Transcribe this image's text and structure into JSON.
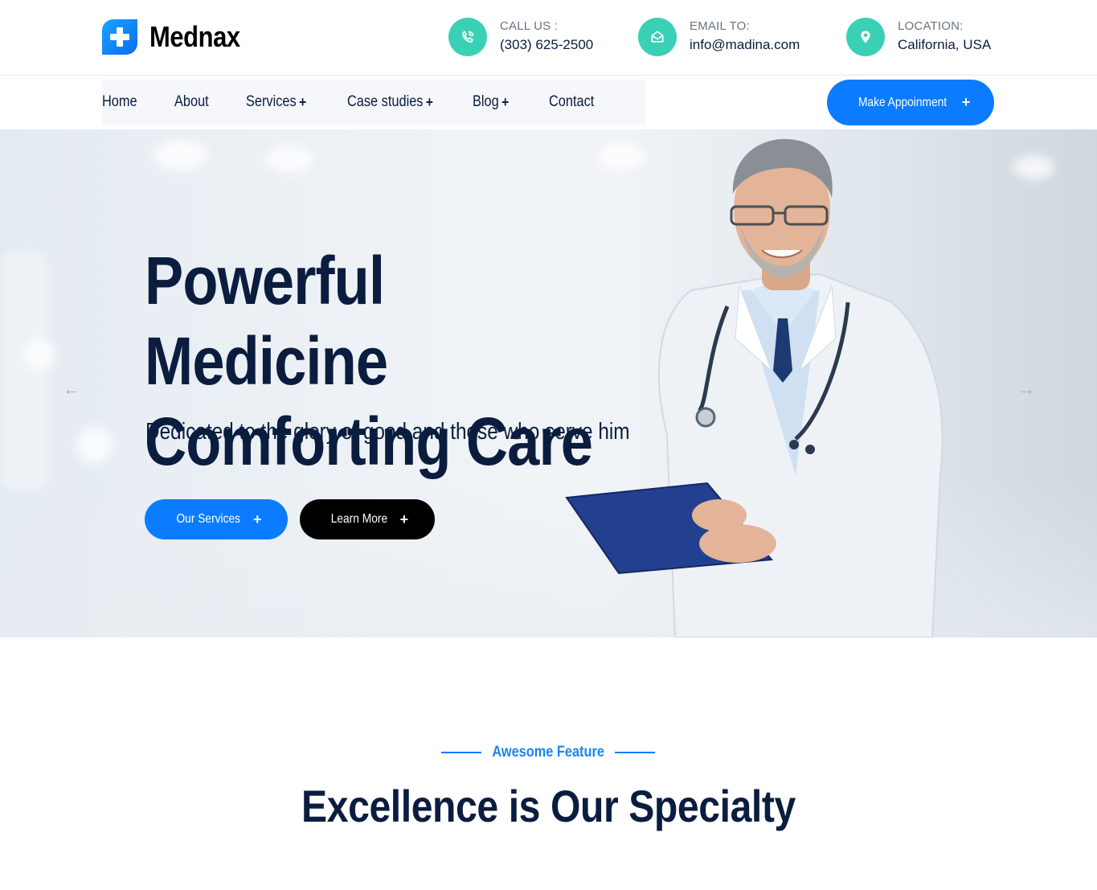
{
  "brand": {
    "name": "Mednax"
  },
  "contact": {
    "phone": {
      "label": "CALL US :",
      "value": "(303) 625-2500"
    },
    "email": {
      "label": "EMAIL TO:",
      "value": "info@madina.com"
    },
    "location": {
      "label": "LOCATION:",
      "value": "California, USA"
    }
  },
  "nav": {
    "items": [
      {
        "label": "Home",
        "has_submenu": false
      },
      {
        "label": "About",
        "has_submenu": false
      },
      {
        "label": "Services",
        "has_submenu": true
      },
      {
        "label": "Case studies",
        "has_submenu": true
      },
      {
        "label": "Blog",
        "has_submenu": true
      },
      {
        "label": "Contact",
        "has_submenu": false
      }
    ],
    "plus": "+",
    "cta": "Make Appoinment"
  },
  "hero": {
    "title_line1": "Powerful Medicine",
    "title_line2": "Comforting Care",
    "subtitle": "Dedicated to the glory of good and those who serve him",
    "primary_button": "Our Services",
    "secondary_button": "Learn More",
    "prev_arrow": "←",
    "next_arrow": "→"
  },
  "feature": {
    "tag": "Awesome Feature",
    "title": "Excellence is Our Specialty"
  },
  "colors": {
    "primary": "#0b7cff",
    "accent_teal": "#3ad0b6",
    "heading": "#0b1d3f"
  }
}
